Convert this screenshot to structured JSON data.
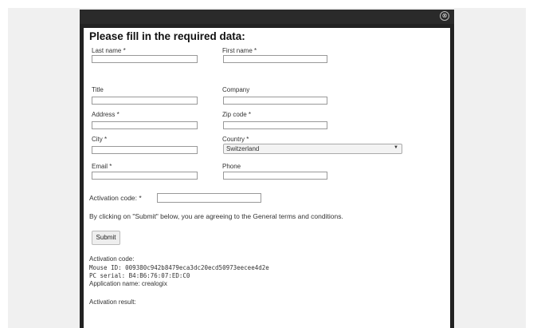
{
  "dialog": {
    "close_glyph": "⊗",
    "heading": "Please fill in the required data:",
    "fields": {
      "last_name": {
        "label": "Last name *",
        "value": ""
      },
      "first_name": {
        "label": "First name *",
        "value": ""
      },
      "title": {
        "label": "Title",
        "value": ""
      },
      "company": {
        "label": "Company",
        "value": ""
      },
      "address": {
        "label": "Address *",
        "value": ""
      },
      "zip": {
        "label": "Zip code *",
        "value": ""
      },
      "city": {
        "label": "City *",
        "value": ""
      },
      "country": {
        "label": "Country *",
        "value": "Switzerland"
      },
      "email": {
        "label": "Email *",
        "value": ""
      },
      "phone": {
        "label": "Phone",
        "value": ""
      },
      "activation_code": {
        "label": "Activation code: *",
        "value": ""
      }
    },
    "consent_text": "By clicking on \"Submit\" below, you are agreeing to the General terms and conditions.",
    "submit_label": "Submit",
    "info": {
      "activation_code_label": "Activation code:",
      "mouse_id": "Mouse ID: 009380c942b8479eca3dc20ecd50973eecee4d2e",
      "pc_serial": "PC serial: B4:B6:76:07:ED:C0",
      "application_name": "Application name: crealogix",
      "activation_result": "Activation result:"
    }
  },
  "colors": {
    "modal_border": "#222222",
    "page_background": "#f0f0f0"
  }
}
